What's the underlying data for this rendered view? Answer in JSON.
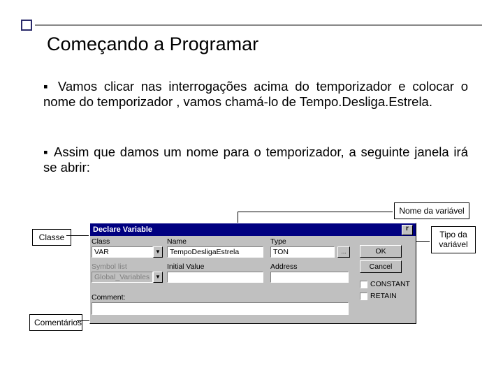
{
  "title": "Começando a Programar",
  "para1": "Vamos clicar nas interrogações acima do temporizador e colocar o nome do temporizador , vamos chamá-lo de Tempo.Desliga.Estrela.",
  "para2": "Assim que damos um nome para o temporizador, a seguinte janela irá se abrir:",
  "callouts": {
    "classe": "Classe",
    "nome": "Nome da variável",
    "tipo": "Tipo da variável",
    "comentarios": "Comentários"
  },
  "dialog": {
    "title": "Declare Variable",
    "labels": {
      "class": "Class",
      "name": "Name",
      "type": "Type",
      "symbollist": "Symbol list",
      "initialvalue": "Initial Value",
      "address": "Address",
      "comment": "Comment:"
    },
    "values": {
      "class": "VAR",
      "name": "TempoDesligaEstrela",
      "type": "TON",
      "symbollist": "Global_Variables"
    },
    "buttons": {
      "ok": "OK",
      "cancel": "Cancel",
      "ellipsis": "..."
    },
    "checkboxes": {
      "constant": "CONSTANT",
      "retain": "RETAIN"
    }
  }
}
